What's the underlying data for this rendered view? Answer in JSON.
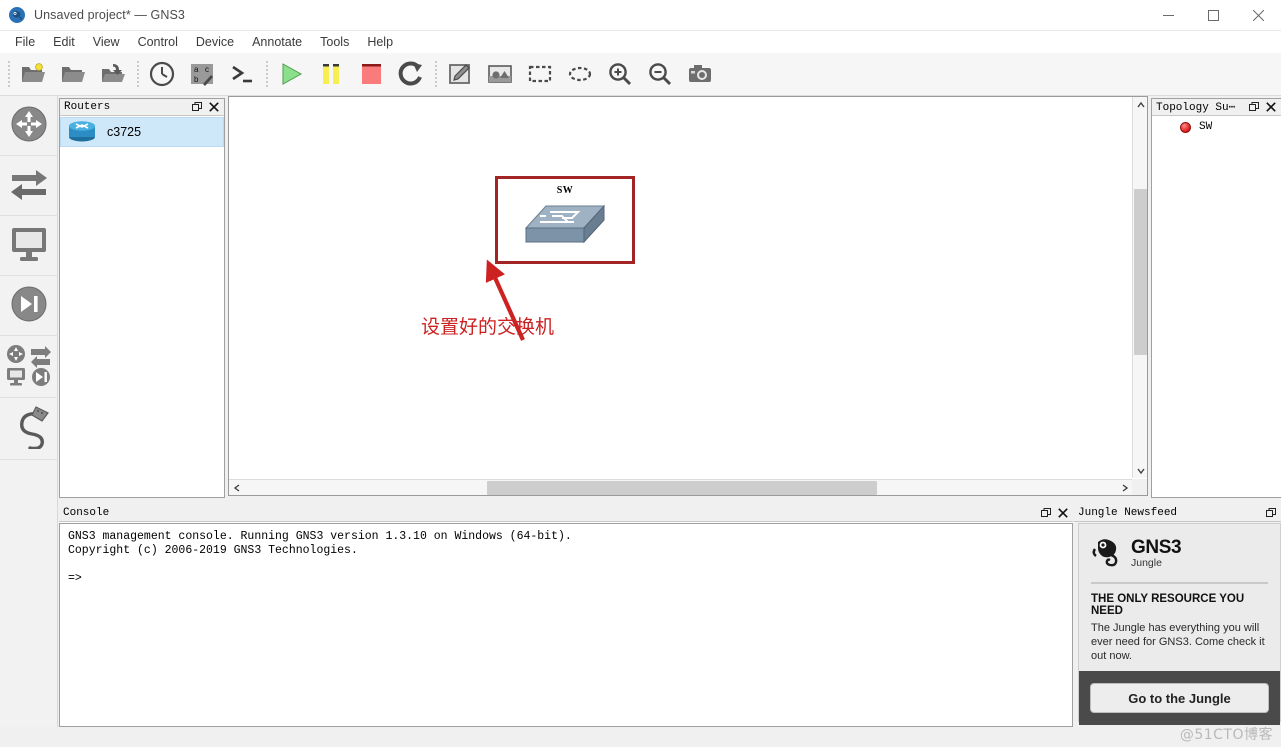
{
  "window": {
    "title": "Unsaved project* — GNS3",
    "app_icon": "gns3-chameleon-icon",
    "minimize": "—",
    "maximize": "□",
    "close": "✕"
  },
  "menubar": {
    "items": [
      {
        "label": "File"
      },
      {
        "label": "Edit"
      },
      {
        "label": "View"
      },
      {
        "label": "Control"
      },
      {
        "label": "Device"
      },
      {
        "label": "Annotate"
      },
      {
        "label": "Tools"
      },
      {
        "label": "Help"
      }
    ]
  },
  "toolbar": {
    "groups": [
      {
        "buttons": [
          {
            "name": "new-project-button",
            "icon": "new-folder-icon",
            "tooltip": "New project"
          },
          {
            "name": "open-project-button",
            "icon": "open-folder-icon",
            "tooltip": "Open project"
          },
          {
            "name": "save-project-button",
            "icon": "save-folder-icon",
            "tooltip": "Save project"
          }
        ]
      },
      {
        "buttons": [
          {
            "name": "snapshot-button",
            "icon": "clock-icon",
            "tooltip": "Snapshot"
          },
          {
            "name": "show-hide-names-button",
            "icon": "abc-icon",
            "tooltip": "Show/Hide interface labels"
          },
          {
            "name": "console-all-button",
            "icon": "console-prompt-icon",
            "tooltip": "Console connect to all devices"
          }
        ]
      },
      {
        "buttons": [
          {
            "name": "start-all-button",
            "icon": "play-icon",
            "tooltip": "Start all devices"
          },
          {
            "name": "suspend-all-button",
            "icon": "pause-icon",
            "tooltip": "Suspend all devices"
          },
          {
            "name": "stop-all-button",
            "icon": "stop-icon",
            "tooltip": "Stop all devices"
          },
          {
            "name": "reload-all-button",
            "icon": "reload-icon",
            "tooltip": "Reload all devices"
          }
        ]
      },
      {
        "buttons": [
          {
            "name": "add-note-button",
            "icon": "note-pencil-icon",
            "tooltip": "Add a note"
          },
          {
            "name": "insert-image-button",
            "icon": "image-icon",
            "tooltip": "Insert a picture"
          },
          {
            "name": "draw-rectangle-button",
            "icon": "rectangle-icon",
            "tooltip": "Draw a rectangle"
          },
          {
            "name": "draw-ellipse-button",
            "icon": "ellipse-icon",
            "tooltip": "Draw an ellipse"
          },
          {
            "name": "zoom-in-button",
            "icon": "zoom-in-icon",
            "tooltip": "Zoom in"
          },
          {
            "name": "zoom-out-button",
            "icon": "zoom-out-icon",
            "tooltip": "Zoom out"
          },
          {
            "name": "screenshot-button",
            "icon": "camera-icon",
            "tooltip": "Take a screenshot"
          }
        ]
      }
    ]
  },
  "device_toolbar": {
    "items": [
      {
        "name": "routers-category",
        "icon": "router-icon",
        "tooltip": "Routers"
      },
      {
        "name": "switches-category",
        "icon": "switch-arrows-icon",
        "tooltip": "Switches"
      },
      {
        "name": "end-devices-category",
        "icon": "monitor-icon",
        "tooltip": "End devices"
      },
      {
        "name": "security-devices-category",
        "icon": "firewall-icon",
        "tooltip": "Security devices"
      },
      {
        "name": "all-devices-category",
        "icon": "all-devices-icon",
        "tooltip": "All devices"
      },
      {
        "name": "add-link-button",
        "icon": "cable-link-icon",
        "tooltip": "Add a link"
      }
    ]
  },
  "routers_dock": {
    "title": "Routers",
    "undock_icon": "undock-icon",
    "close_icon": "close-icon",
    "items": [
      {
        "label": "c3725",
        "icon": "router-icon",
        "selected": true
      }
    ]
  },
  "canvas": {
    "node": {
      "label": "SW",
      "icon": "ethernet-switch-icon"
    },
    "annotations": {
      "rectangle_color": "#a32424",
      "arrow_color": "#cc2222",
      "text": "设置好的交换机",
      "text_color": "#cc2222"
    },
    "scrollbars": {
      "up_arrow": "⌃",
      "down_arrow": "⌄",
      "left_arrow": "‹",
      "right_arrow": "›"
    }
  },
  "topology_dock": {
    "title": "Topology Su⋯",
    "undock_icon": "undock-icon",
    "close_icon": "close-icon",
    "items": [
      {
        "label": "SW",
        "status": "stopped",
        "status_color": "#e02020"
      }
    ]
  },
  "console_dock": {
    "title": "Console",
    "undock_icon": "undock-icon",
    "close_icon": "close-icon",
    "lines": "GNS3 management console. Running GNS3 version 1.3.10 on Windows (64-bit).\nCopyright (c) 2006-2019 GNS3 Technologies.\n\n=>"
  },
  "jungle_dock": {
    "title": "Jungle Newsfeed",
    "undock_icon": "undock-icon",
    "logo_icon": "gns3-chameleon-logo",
    "brand_primary": "GNS3",
    "brand_secondary": "Jungle",
    "headline": "THE ONLY RESOURCE YOU NEED",
    "body": "The Jungle has everything you will ever need for GNS3. Come check it out now.",
    "cta_label": "Go to the Jungle"
  },
  "watermark": "@51CTO博客"
}
